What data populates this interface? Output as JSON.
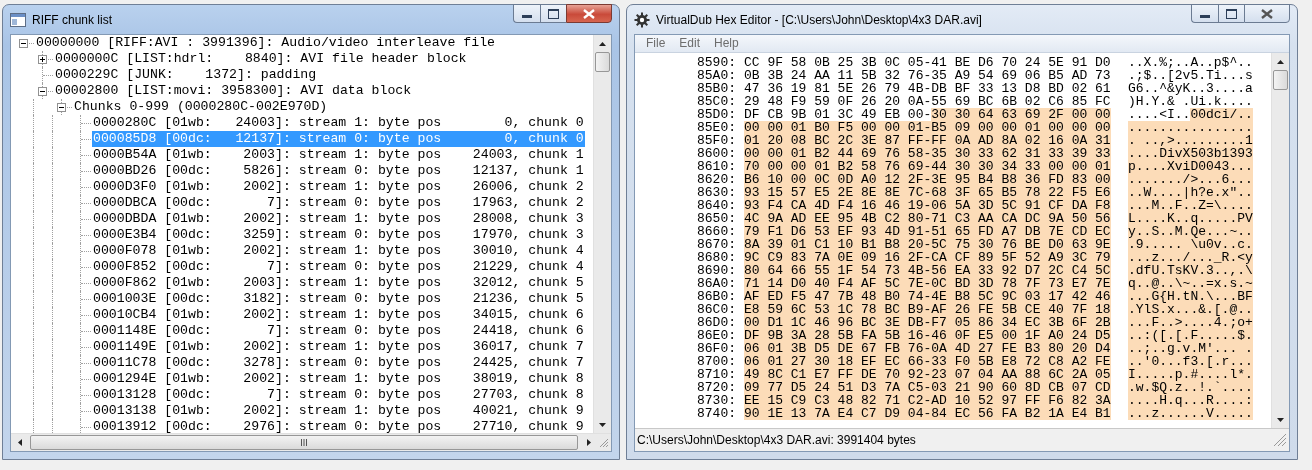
{
  "windows": [
    {
      "title": "RIFF chunk list",
      "active": true,
      "tree": [
        {
          "text": "00000000 [RIFF:AVI : 3991396]: Audio/video interleave file",
          "selected": false,
          "expanded": true,
          "children": [
            {
              "text": "0000000C [LIST:hdrl:    8840]: AVI file header block",
              "selected": false,
              "expanded": false
            },
            {
              "text": "0000229C [JUNK:    1372]: padding",
              "selected": false
            },
            {
              "text": "00002800 [LIST:movi: 3958300]: AVI data block",
              "selected": false,
              "expanded": true,
              "children": [
                {
                  "text": "Chunks 0-999 (0000280C-002E970D)",
                  "selected": false,
                  "expanded": true,
                  "children": [
                    {
                      "text": "0000280C [01wb:   24003]: stream 1: byte pos        0, chunk 0",
                      "selected": false
                    },
                    {
                      "text": "000085D8 [00dc:   12137]: stream 0: byte pos        0, chunk 0",
                      "selected": true
                    },
                    {
                      "text": "0000B54A [01wb:    2003]: stream 1: byte pos    24003, chunk 1",
                      "selected": false
                    },
                    {
                      "text": "0000BD26 [00dc:    5826]: stream 0: byte pos    12137, chunk 1",
                      "selected": false
                    },
                    {
                      "text": "0000D3F0 [01wb:    2002]: stream 1: byte pos    26006, chunk 2",
                      "selected": false
                    },
                    {
                      "text": "0000DBCA [00dc:       7]: stream 0: byte pos    17963, chunk 2",
                      "selected": false
                    },
                    {
                      "text": "0000DBDA [01wb:    2002]: stream 1: byte pos    28008, chunk 3",
                      "selected": false
                    },
                    {
                      "text": "0000E3B4 [00dc:    3259]: stream 0: byte pos    17970, chunk 3",
                      "selected": false
                    },
                    {
                      "text": "0000F078 [01wb:    2002]: stream 1: byte pos    30010, chunk 4",
                      "selected": false
                    },
                    {
                      "text": "0000F852 [00dc:       7]: stream 0: byte pos    21229, chunk 4",
                      "selected": false
                    },
                    {
                      "text": "0000F862 [01wb:    2003]: stream 1: byte pos    32012, chunk 5",
                      "selected": false
                    },
                    {
                      "text": "0001003E [00dc:    3182]: stream 0: byte pos    21236, chunk 5",
                      "selected": false
                    },
                    {
                      "text": "00010CB4 [01wb:    2002]: stream 1: byte pos    34015, chunk 6",
                      "selected": false
                    },
                    {
                      "text": "0001148E [00dc:       7]: stream 0: byte pos    24418, chunk 6",
                      "selected": false
                    },
                    {
                      "text": "0001149E [01wb:    2002]: stream 1: byte pos    36017, chunk 7",
                      "selected": false
                    },
                    {
                      "text": "00011C78 [00dc:    3278]: stream 0: byte pos    24425, chunk 7",
                      "selected": false
                    },
                    {
                      "text": "0001294E [01wb:    2002]: stream 1: byte pos    38019, chunk 8",
                      "selected": false
                    },
                    {
                      "text": "00013128 [00dc:       7]: stream 0: byte pos    27703, chunk 8",
                      "selected": false
                    },
                    {
                      "text": "00013138 [01wb:    2002]: stream 1: byte pos    40021, chunk 9",
                      "selected": false
                    },
                    {
                      "text": "00013912 [00dc:    2976]: stream 0: byte pos    27710, chunk 9",
                      "selected": false
                    }
                  ]
                }
              ]
            }
          ]
        }
      ]
    },
    {
      "title": "VirtualDub Hex Editor - [C:\\Users\\John\\Desktop\\4x3 DAR.avi]",
      "active": false,
      "menu": [
        "File",
        "Edit",
        "Help"
      ],
      "hex_rows": [
        {
          "offset": "8590:",
          "hex": "CC 9F 58 0B 25 3B 0C 05-41 BE D6 70 24 5E 91 D0",
          "ascii": "..X.%;..A..p$^.."
        },
        {
          "offset": "85A0:",
          "hex": "0B 3B 24 AA 11 5B 32 76-35 A9 54 69 06 B5 AD 73",
          "ascii": ".;$..[2v5.Ti...s"
        },
        {
          "offset": "85B0:",
          "hex": "47 36 19 81 5E 26 79 4B-DB BF 33 13 D8 BD 02 61",
          "ascii": "G6..^&yK..3....a"
        },
        {
          "offset": "85C0:",
          "hex": "29 48 F9 59 0F 26 20 0A-55 69 BC 6B 02 C6 85 FC",
          "ascii": ")H.Y.& .Ui.k...."
        },
        {
          "offset": "85D0:",
          "hex": "DF CB 9B 01 3C 49 EB 00-",
          "hex_selected": "30 30 64 63 69 2F 00 00",
          "ascii": "....<I..",
          "ascii_selected": "00dci/.."
        },
        {
          "offset": "85E0:",
          "hex_selected": "00 00 01 B0 F5 00 00 01-B5 09 00 00 01 00 00 00",
          "ascii_selected": "................"
        },
        {
          "offset": "85F0:",
          "hex_selected": "01 20 08 BC 2C 3E 87 FF-FF 0A AD 8A 02 16 0A 31",
          "ascii_selected": ". ..,>.........1"
        },
        {
          "offset": "8600:",
          "hex_selected": "00 00 01 B2 44 69 76 58-35 30 33 62 31 33 39 33",
          "ascii_selected": "....DivX503b1393"
        },
        {
          "offset": "8610:",
          "hex_selected": "70 00 00 01 B2 58 76 69-44 30 30 34 33 00 00 01",
          "ascii_selected": "p....XviD0043..."
        },
        {
          "offset": "8620:",
          "hex_selected": "B6 10 00 0C 0D A0 12 2F-3E 95 B4 B8 36 FD 83 00",
          "ascii_selected": "......./>...6..."
        },
        {
          "offset": "8630:",
          "hex_selected": "93 15 57 E5 2E 8E 8E 7C-68 3F 65 B5 78 22 F5 E6",
          "ascii_selected": "..W....|h?e.x\".."
        },
        {
          "offset": "8640:",
          "hex_selected": "93 F4 CA 4D F4 16 46 19-06 5A 3D 5C 91 CF DA F8",
          "ascii_selected": "...M..F..Z=\\...."
        },
        {
          "offset": "8650:",
          "hex_selected": "4C 9A AD EE 95 4B C2 80-71 C3 AA CA DC 9A 50 56",
          "ascii_selected": "L....K..q.....PV"
        },
        {
          "offset": "8660:",
          "hex_selected": "79 F1 D6 53 EF 93 4D 91-51 65 FD A7 DB 7E CD EC",
          "ascii_selected": "y..S..M.Qe...~.."
        },
        {
          "offset": "8670:",
          "hex_selected": "8A 39 01 C1 10 B1 B8 20-5C 75 30 76 BE D0 63 9E",
          "ascii_selected": ".9..... \\u0v..c."
        },
        {
          "offset": "8680:",
          "hex_selected": "9C C9 83 7A 0E 09 16 2F-CA CF 89 5F 52 A9 3C 79",
          "ascii_selected": "...z.../..._R.<y"
        },
        {
          "offset": "8690:",
          "hex_selected": "80 64 66 55 1F 54 73 4B-56 EA 33 92 D7 2C C4 5C",
          "ascii_selected": ".dfU.TsKV.3..,.\\"
        },
        {
          "offset": "86A0:",
          "hex_selected": "71 14 D0 40 F4 AF 5C 7E-0C BD 3D 78 7F 73 E7 7E",
          "ascii_selected": "q..@..\\~..=x.s.~"
        },
        {
          "offset": "86B0:",
          "hex_selected": "AF ED F5 47 7B 48 B0 74-4E B8 5C 9C 03 17 42 46",
          "ascii_selected": "...G{H.tN.\\...BF"
        },
        {
          "offset": "86C0:",
          "hex_selected": "E8 59 6C 53 1C 78 BC B9-AF 26 FE 5B CE 40 7F 18",
          "ascii_selected": ".YlS.x...&.[.@.."
        },
        {
          "offset": "86D0:",
          "hex_selected": "00 D1 1C 46 96 BC 3E DB-F7 05 86 34 EC 3B 6F 2B",
          "ascii_selected": "...F..>....4.;o+"
        },
        {
          "offset": "86E0:",
          "hex_selected": "DF 9B 3A 28 5B FA 5B 16-46 0F E5 00 1F A0 24 D5",
          "ascii_selected": "..:([.[.F.....$."
        },
        {
          "offset": "86F0:",
          "hex_selected": "06 01 3B D5 DE 67 FB 76-0A 4D 27 FE B3 80 20 D4",
          "ascii_selected": "..;..g.v.M'... ."
        },
        {
          "offset": "8700:",
          "hex_selected": "06 01 27 30 18 EF EC 66-33 F0 5B E8 72 C8 A2 FE",
          "ascii_selected": "..'0...f3.[.r..."
        },
        {
          "offset": "8710:",
          "hex_selected": "49 8C C1 E7 FF DE 70 92-23 07 04 AA 88 6C 2A 05",
          "ascii_selected": "I.....p.#....l*."
        },
        {
          "offset": "8720:",
          "hex_selected": "09 77 D5 24 51 D3 7A C5-03 21 90 60 8D CB 07 CD",
          "ascii_selected": ".w.$Q.z..!.`...."
        },
        {
          "offset": "8730:",
          "hex_selected": "EE 15 C9 C3 48 82 71 C2-AD 10 52 97 FF F6 82 3A",
          "ascii_selected": "....H.q...R....:"
        },
        {
          "offset": "8740:",
          "hex_selected": "90 1E 13 7A E4 C7 D9 04-84 EC 56 FA B2 1A E4 B1",
          "ascii_selected": "...z......V....."
        }
      ],
      "status": "C:\\Users\\John\\Desktop\\4x3 DAR.avi: 3991404 bytes"
    }
  ]
}
